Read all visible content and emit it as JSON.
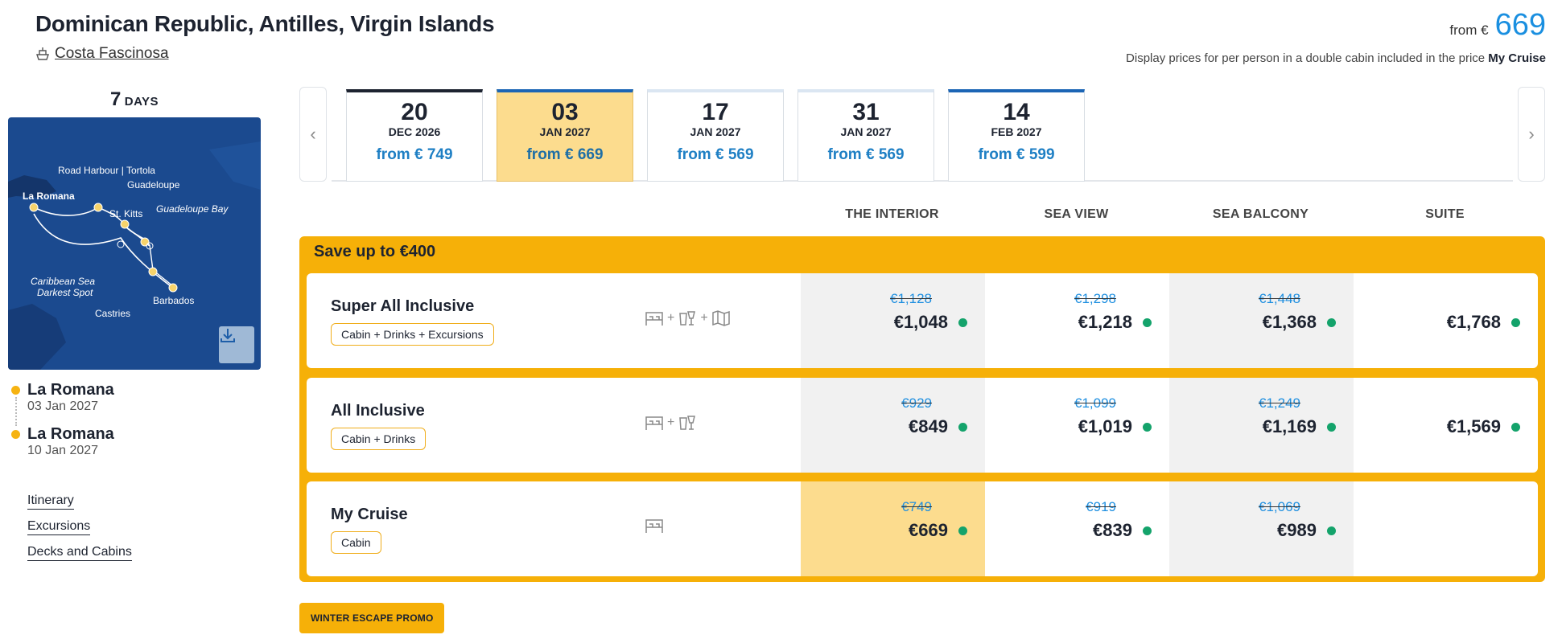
{
  "header": {
    "title": "Dominican Republic, Antilles, Virgin Islands",
    "ship": "Costa Fascinosa",
    "from_label": "from €",
    "from_amount": "669",
    "disclaimer": "Display prices for per person in a double cabin included in the price",
    "disclaimer_bold": "My Cruise"
  },
  "sidebar": {
    "days_num": "7",
    "days_unit": "DAYS",
    "map_labels": {
      "la_romana": "La Romana",
      "road_harbour": "Road Harbour | Tortola",
      "guadeloupe": "Guadeloupe",
      "st_kitts": "St. Kitts",
      "guadeloupe_bay": "Guadeloupe Bay",
      "caribbean_sea": "Caribbean Sea",
      "darkest_spot": "Darkest Spot",
      "barbados": "Barbados",
      "castries": "Castries"
    },
    "stops": [
      {
        "name": "La Romana",
        "date": "03 Jan 2027"
      },
      {
        "name": "La Romana",
        "date": "10 Jan 2027"
      }
    ],
    "links": [
      "Itinerary",
      "Excursions",
      "Decks and Cabins"
    ]
  },
  "dates": [
    {
      "day": "20",
      "month": "DEC 2026",
      "price": "from € 749"
    },
    {
      "day": "03",
      "month": "JAN 2027",
      "price": "from € 669"
    },
    {
      "day": "17",
      "month": "JAN 2027",
      "price": "from € 569"
    },
    {
      "day": "31",
      "month": "JAN 2027",
      "price": "from € 569"
    },
    {
      "day": "14",
      "month": "FEB 2027",
      "price": "from € 599"
    }
  ],
  "columns": [
    "THE INTERIOR",
    "SEA VIEW",
    "SEA BALCONY",
    "SUITE"
  ],
  "save_label": "Save up to €400",
  "packages": [
    {
      "name": "Super All Inclusive",
      "tag": "Cabin + Drinks + Excursions",
      "plus": "+",
      "prices": [
        {
          "old": "€1,128",
          "new": "€1,048"
        },
        {
          "old": "€1,298",
          "new": "€1,218"
        },
        {
          "old": "€1,448",
          "new": "€1,368"
        },
        {
          "old": "",
          "new": "€1,768"
        }
      ]
    },
    {
      "name": "All Inclusive",
      "tag": "Cabin + Drinks",
      "plus": "+",
      "prices": [
        {
          "old": "€929",
          "new": "€849"
        },
        {
          "old": "€1,099",
          "new": "€1,019"
        },
        {
          "old": "€1,249",
          "new": "€1,169"
        },
        {
          "old": "",
          "new": "€1,569"
        }
      ]
    },
    {
      "name": "My Cruise",
      "tag": "Cabin",
      "prices": [
        {
          "old": "€749",
          "new": "€669"
        },
        {
          "old": "€919",
          "new": "€839"
        },
        {
          "old": "€1,069",
          "new": "€989"
        }
      ]
    }
  ],
  "promo": "WINTER ESCAPE PROMO",
  "colors": {
    "accent_yellow": "#f6b008",
    "selected_date": "#fcdc8e",
    "price_blue": "#1e7fc4",
    "available_green": "#14a36b",
    "map_sea": "#1b4a8f"
  }
}
